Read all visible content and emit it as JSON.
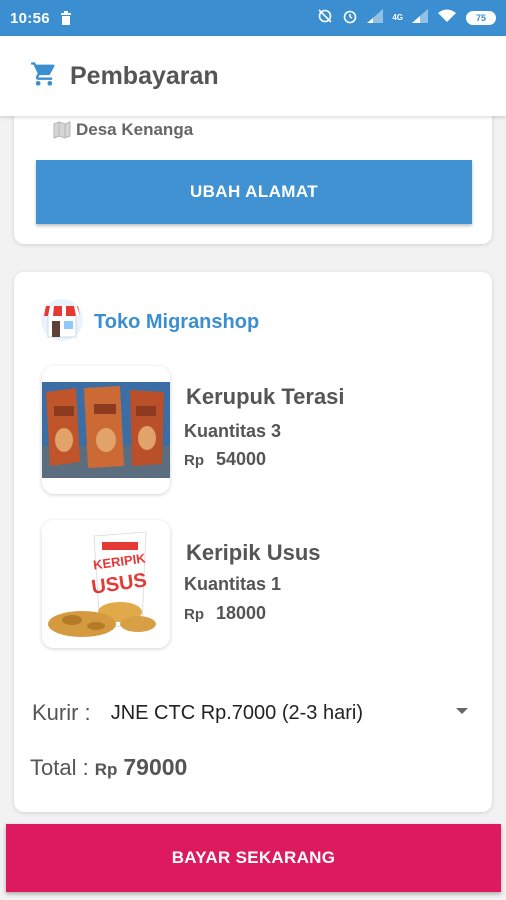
{
  "status_bar": {
    "time": "10:56",
    "network": "4G",
    "battery": "75"
  },
  "app_bar": {
    "title": "Pembayaran",
    "icon": "cart-icon"
  },
  "address": {
    "village": "Desa Kenanga",
    "change_button": "UBAH ALAMAT"
  },
  "shop": {
    "name": "Toko Migranshop",
    "products": [
      {
        "name": "Kerupuk Terasi",
        "quantity": "Kuantitas 3",
        "currency": "Rp",
        "price": "54000"
      },
      {
        "name": "Keripik Usus",
        "quantity": "Kuantitas 1",
        "currency": "Rp",
        "price": "18000",
        "image_text": "KERIPIK USUS"
      }
    ]
  },
  "courier": {
    "label": "Kurir :",
    "selected": "JNE CTC Rp.7000 (2-3 hari)"
  },
  "total": {
    "label": "Total :",
    "currency": "Rp",
    "value": "79000"
  },
  "pay_button": "BAYAR SEKARANG",
  "colors": {
    "primary": "#3b8fd0",
    "button_blue": "#4192d3",
    "pay": "#dd1a5f"
  }
}
